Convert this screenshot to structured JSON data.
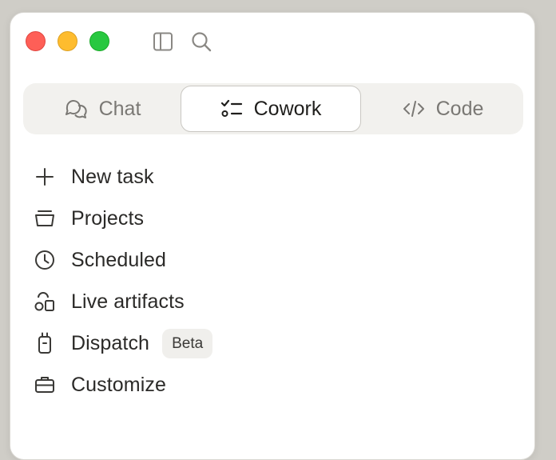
{
  "window": {
    "controls": [
      "close",
      "minimize",
      "zoom"
    ]
  },
  "toolbar": {
    "sidebar_icon": "sidebar-icon",
    "search_icon": "search-icon"
  },
  "mode_tabs": [
    {
      "label": "Chat",
      "icon": "chat-bubbles-icon",
      "selected": false
    },
    {
      "label": "Cowork",
      "icon": "checklist-icon",
      "selected": true
    },
    {
      "label": "Code",
      "icon": "code-brackets-icon",
      "selected": false
    }
  ],
  "nav": {
    "items": [
      {
        "label": "New task",
        "icon": "plus-icon"
      },
      {
        "label": "Projects",
        "icon": "folder-tray-icon"
      },
      {
        "label": "Scheduled",
        "icon": "clock-icon"
      },
      {
        "label": "Live artifacts",
        "icon": "shapes-icon"
      },
      {
        "label": "Dispatch",
        "icon": "device-icon",
        "badge": "Beta"
      },
      {
        "label": "Customize",
        "icon": "briefcase-icon"
      }
    ]
  },
  "colors": {
    "accent_text": "#1f1e1c",
    "muted_text": "#7a7874",
    "tab_bar_bg": "#f2f1ee",
    "close": "#fe5f57",
    "minimize": "#febc2e",
    "zoom": "#28c840"
  }
}
